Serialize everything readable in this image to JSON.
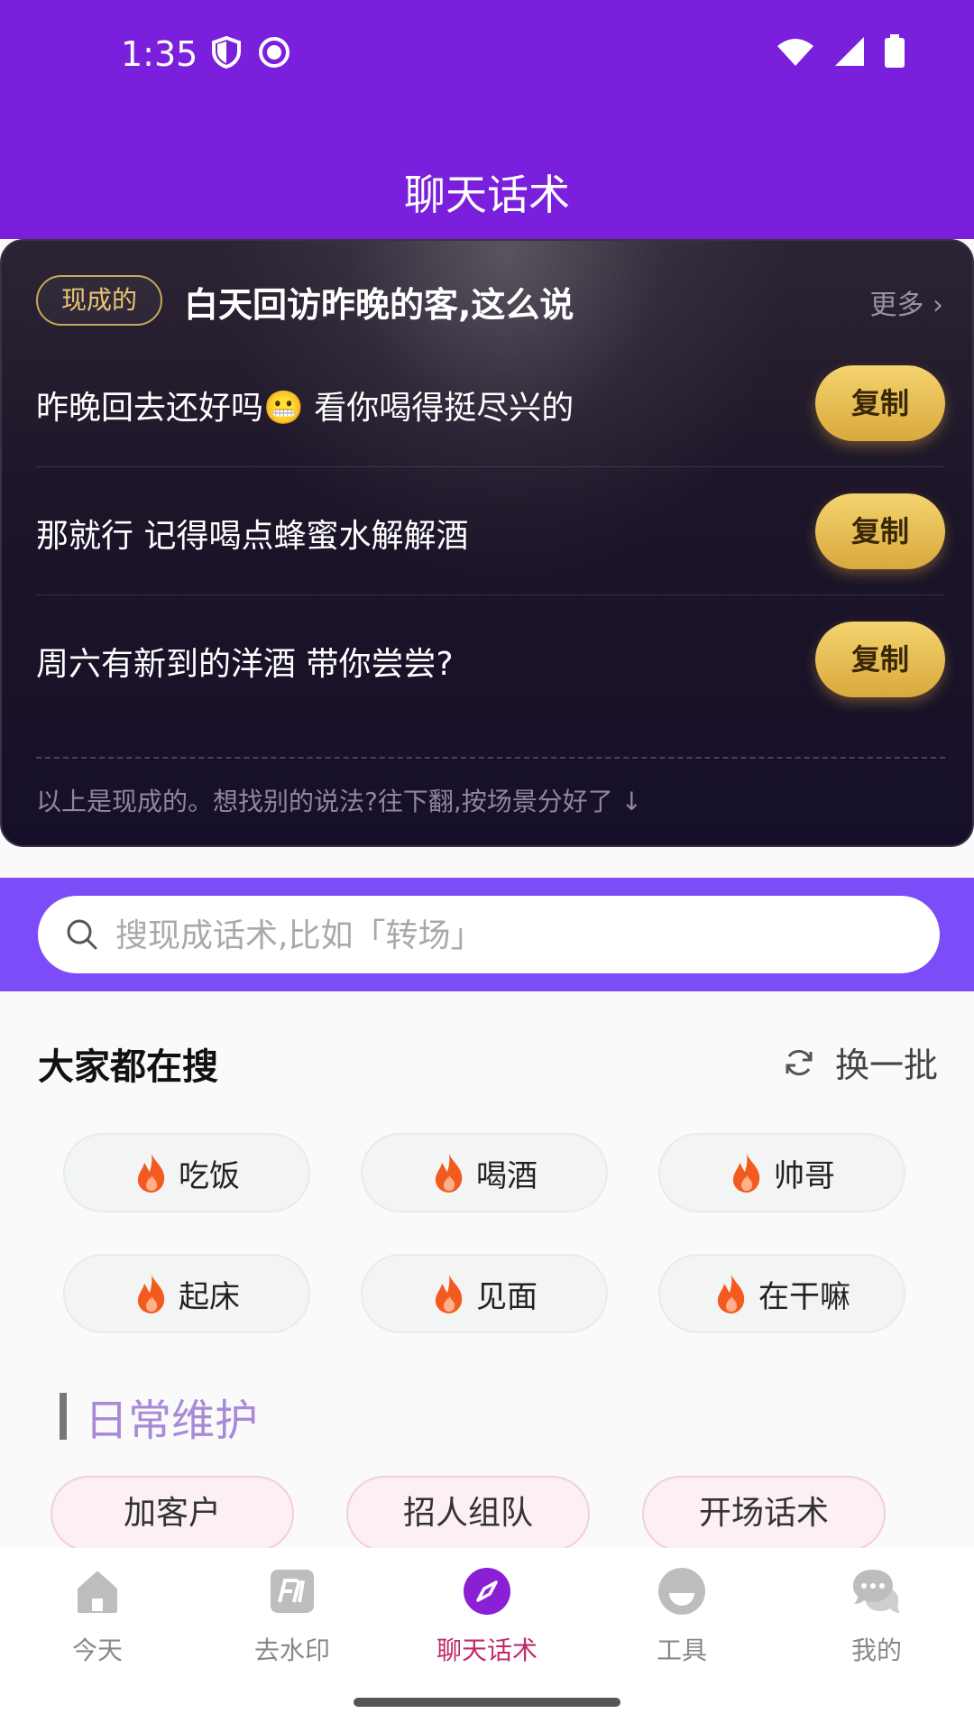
{
  "status_bar": {
    "time": "1:35"
  },
  "header": {
    "title": "聊天话术"
  },
  "ready_card": {
    "badge": "现成的",
    "title": "白天回访昨晚的客,这么说",
    "more": "更多 ›",
    "phrases": [
      {
        "text": "昨晚回去还好吗😬 看你喝得挺尽兴的",
        "copy_label": "复制"
      },
      {
        "text": "那就行 记得喝点蜂蜜水解解酒",
        "copy_label": "复制"
      },
      {
        "text": "周六有新到的洋酒 带你尝尝?",
        "copy_label": "复制"
      }
    ],
    "hint": "以上是现成的。想找别的说法?往下翻,按场景分好了 ↓"
  },
  "search": {
    "placeholder": "搜现成话术,比如「转场」"
  },
  "hot_searches": {
    "title": "大家都在搜",
    "refresh_label": "换一批",
    "chips": [
      "吃饭",
      "喝酒",
      "帅哥",
      "起床",
      "见面",
      "在干嘛"
    ]
  },
  "section": {
    "title": "日常维护",
    "chips": [
      "加客户",
      "招人组队",
      "开场话术"
    ]
  },
  "bottom_nav": {
    "items": [
      {
        "label": "今天",
        "icon": "home-icon"
      },
      {
        "label": "去水印",
        "icon": "watermark-icon"
      },
      {
        "label": "聊天话术",
        "icon": "compass-icon",
        "active": true
      },
      {
        "label": "工具",
        "icon": "tools-icon"
      },
      {
        "label": "我的",
        "icon": "chat-bubbles-icon"
      }
    ]
  },
  "colors": {
    "header": "#7a1fdc",
    "search_band": "#7b4cf7",
    "copy_button": "#e8bf55",
    "active_tab": "#c02a6a"
  }
}
